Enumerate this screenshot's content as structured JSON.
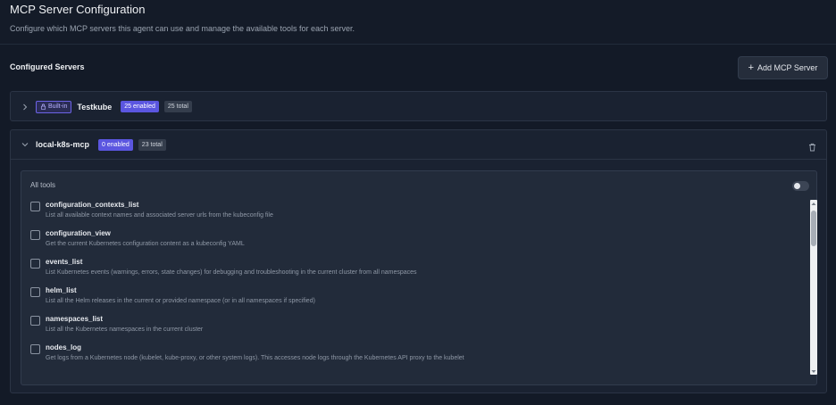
{
  "header": {
    "title": "MCP Server Configuration",
    "subtitle": "Configure which MCP servers this agent can use and manage the available tools for each server."
  },
  "section": {
    "title": "Configured Servers",
    "add_button_label": "Add MCP Server"
  },
  "servers": [
    {
      "builtin_label": "Built-in",
      "name": "Testkube",
      "enabled_badge": "25 enabled",
      "total_badge": "25 total",
      "expanded": false
    },
    {
      "name": "local-k8s-mcp",
      "enabled_badge": "0 enabled",
      "total_badge": "23 total",
      "expanded": true,
      "all_tools_label": "All tools",
      "all_tools_enabled": false,
      "tools": [
        {
          "name": "configuration_contexts_list",
          "description": "List all available context names and associated server urls from the kubeconfig file",
          "checked": false
        },
        {
          "name": "configuration_view",
          "description": "Get the current Kubernetes configuration content as a kubeconfig YAML",
          "checked": false
        },
        {
          "name": "events_list",
          "description": "List Kubernetes events (warnings, errors, state changes) for debugging and troubleshooting in the current cluster from all namespaces",
          "checked": false
        },
        {
          "name": "helm_list",
          "description": "List all the Helm releases in the current or provided namespace (or in all namespaces if specified)",
          "checked": false
        },
        {
          "name": "namespaces_list",
          "description": "List all the Kubernetes namespaces in the current cluster",
          "checked": false
        },
        {
          "name": "nodes_log",
          "description": "Get logs from a Kubernetes node (kubelet, kube-proxy, or other system logs). This accesses node logs through the Kubernetes API proxy to the kubelet",
          "checked": false
        }
      ]
    }
  ],
  "colors": {
    "background": "#131a27",
    "accent": "#5b56e0",
    "card": "#1a2231"
  },
  "icons": {
    "collapsed": "chevron-right-icon",
    "expanded": "chevron-down-icon",
    "builtin": "lock-icon",
    "delete": "trash-icon",
    "add": "plus-icon"
  }
}
